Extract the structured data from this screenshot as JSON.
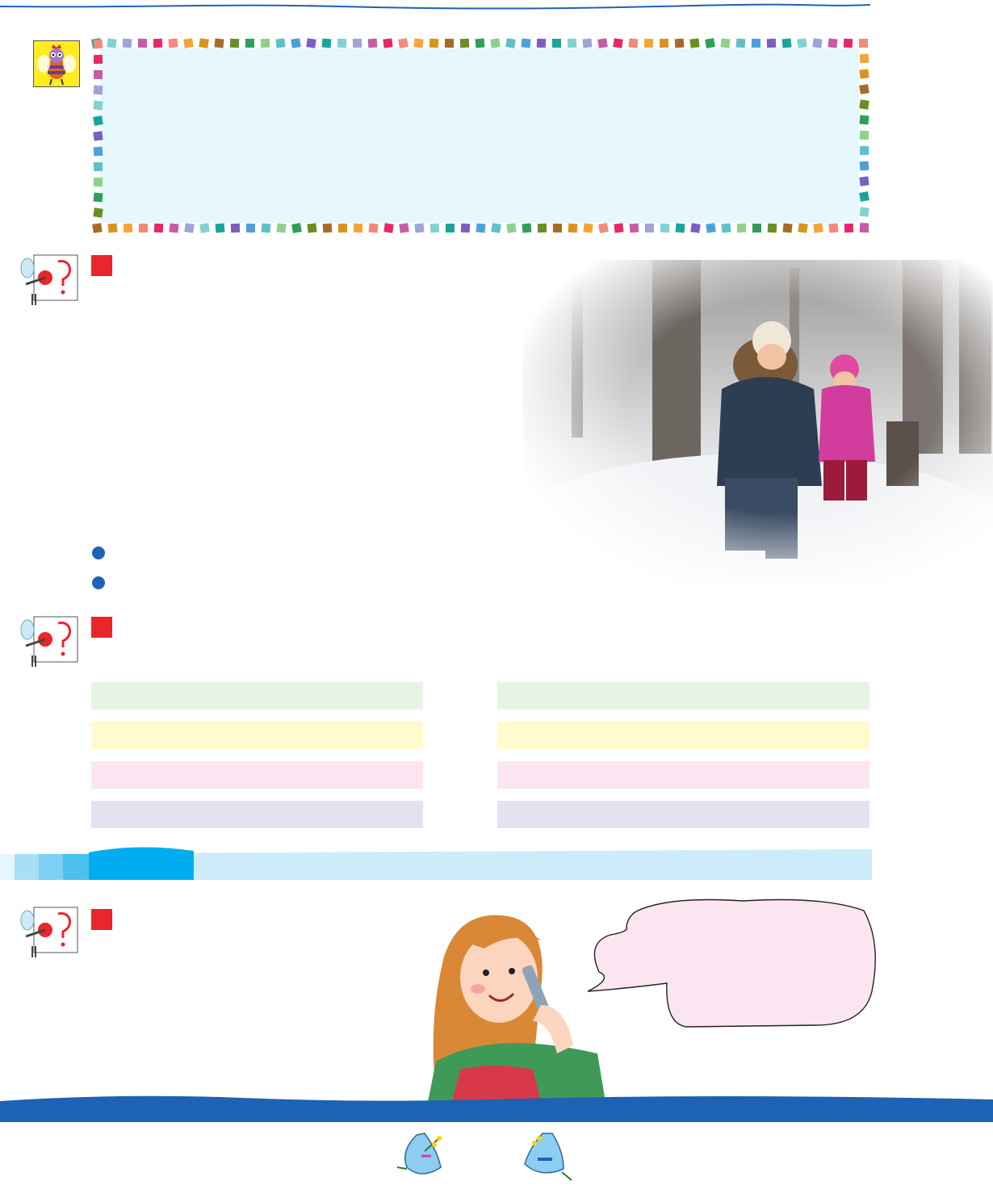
{
  "colors": {
    "accent_blue": "#1d62b4",
    "flag_red": "#e8262b",
    "rule_box_fill": "#e6f7fd",
    "band_light": "#ccecfa",
    "band_dark": "#00aeef",
    "bubble_fill": "#fbe5f1",
    "row_colors": [
      "#e6f5e3",
      "#fffbcf",
      "#fbe5f1",
      "#e6e1f1"
    ]
  },
  "icons": {
    "rule_icon": "bee-icon",
    "question_icon": "mosquito-question-icon",
    "task_marker": "red-square-icon",
    "bullet": "blue-dot-icon",
    "footer_decor": "bluebell-flower-icon"
  }
}
